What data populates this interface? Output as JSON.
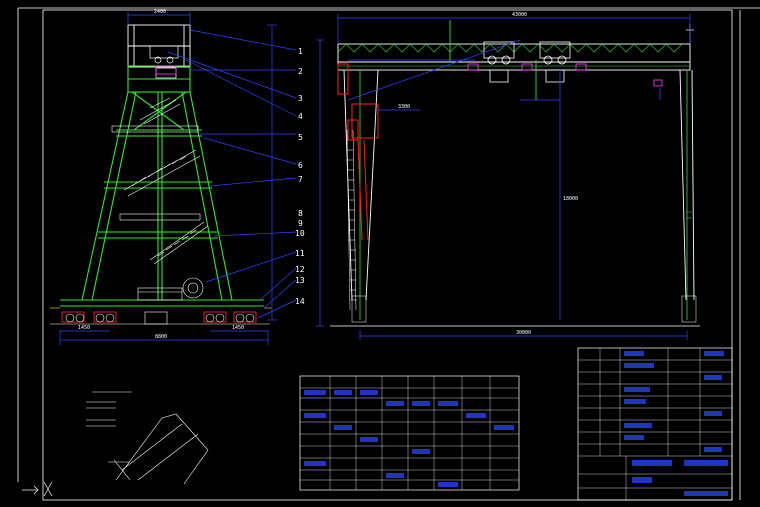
{
  "callouts": [
    "1",
    "2",
    "3",
    "4",
    "5",
    "6",
    "7",
    "8",
    "9",
    "10",
    "11",
    "12",
    "13",
    "14"
  ],
  "dimensions": {
    "left_top": "2400",
    "left_bottom_total": "8800",
    "left_bottom_a": "1450",
    "left_bottom_b": "1450",
    "right_top_total": "43000",
    "right_bottom_total": "30000",
    "right_height": "18000",
    "right_trolley": "3300"
  },
  "colors": {
    "structure": "#2ee82e",
    "dimension": "#2b47ff",
    "highlight": "#ff1f1f",
    "white": "#ffffff",
    "magenta": "#ff3cff",
    "yellow": "#ffe600",
    "cyan": "#22e6ff"
  },
  "icons": {
    "ucs": "ucs-axis-icon",
    "arrow": "axis-arrow-icon"
  }
}
